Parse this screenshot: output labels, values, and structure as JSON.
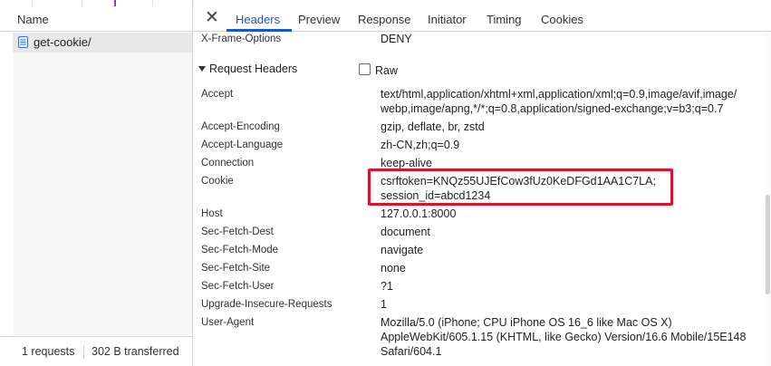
{
  "left_panel": {
    "column_header": "Name",
    "request": {
      "name": "get-cookie/",
      "icon": "document-icon"
    },
    "status": {
      "requests": "1 requests",
      "transferred": "302 B transferred"
    }
  },
  "tabs": {
    "close_icon": "close-icon",
    "items": [
      "Headers",
      "Preview",
      "Response",
      "Initiator",
      "Timing",
      "Cookies"
    ],
    "active": "Headers"
  },
  "response_headers_tail": {
    "key": "X-Frame-Options",
    "value": "DENY"
  },
  "request_section": {
    "title": "Request Headers",
    "raw_label": "Raw",
    "raw_checked": false,
    "headers": [
      {
        "key": "Accept",
        "lines": [
          "text/html,application/xhtml+xml,application/xml;q=0.9,image/avif,image/",
          "webp,image/apng,*/*;q=0.8,application/signed-exchange;v=b3;q=0.7"
        ]
      },
      {
        "key": "Accept-Encoding",
        "lines": [
          "gzip, deflate, br, zstd"
        ]
      },
      {
        "key": "Accept-Language",
        "lines": [
          "zh-CN,zh;q=0.9"
        ]
      },
      {
        "key": "Connection",
        "lines": [
          "keep-alive"
        ]
      },
      {
        "key": "Cookie",
        "lines": [
          "csrftoken=KNQz55UJEfCow3fUz0KeDFGd1AA1C7LA;",
          "session_id=abcd1234"
        ]
      },
      {
        "key": "Host",
        "lines": [
          "127.0.0.1:8000"
        ]
      },
      {
        "key": "Sec-Fetch-Dest",
        "lines": [
          "document"
        ]
      },
      {
        "key": "Sec-Fetch-Mode",
        "lines": [
          "navigate"
        ]
      },
      {
        "key": "Sec-Fetch-Site",
        "lines": [
          "none"
        ]
      },
      {
        "key": "Sec-Fetch-User",
        "lines": [
          "?1"
        ]
      },
      {
        "key": "Upgrade-Insecure-Requests",
        "lines": [
          "1"
        ]
      },
      {
        "key": "User-Agent",
        "lines": [
          "Mozilla/5.0 (iPhone; CPU iPhone OS 16_6 like Mac OS X)",
          "AppleWebKit/605.1.15 (KHTML, like Gecko) Version/16.6 Mobile/15E148",
          "Safari/604.1"
        ]
      }
    ]
  },
  "colors": {
    "accent": "#1a56c8",
    "highlight": "#e0102a"
  }
}
